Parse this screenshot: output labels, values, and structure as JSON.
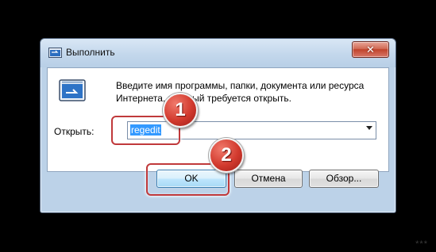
{
  "dialog": {
    "title": "Выполнить",
    "close_label": "✕",
    "description": "Введите имя программы, папки, документа или ресурса Интернета, который требуется открыть.",
    "open_label": "Открыть:",
    "input_value": "regedit",
    "buttons": {
      "ok": "OK",
      "cancel": "Отмена",
      "browse": "Обзор..."
    }
  },
  "annotations": {
    "step1": "1",
    "step2": "2",
    "accent_color": "#c0393b"
  },
  "watermark": "***",
  "icons": [
    "run-app-icon",
    "close-icon",
    "dropdown-arrow-icon"
  ]
}
